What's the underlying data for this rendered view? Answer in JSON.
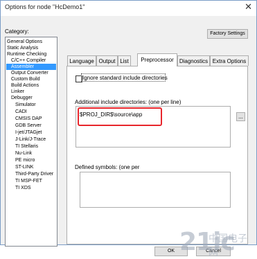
{
  "window": {
    "title": "Options for node \"HcDemo1\"",
    "close_glyph": "✕"
  },
  "category": {
    "label": "Category:",
    "items": [
      {
        "label": "General Options"
      },
      {
        "label": "Static Analysis"
      },
      {
        "label": "Runtime Checking"
      },
      {
        "label": "C/C++ Compiler"
      },
      {
        "label": "Assembler",
        "selected": true
      },
      {
        "label": "Output Converter"
      },
      {
        "label": "Custom Build"
      },
      {
        "label": "Build Actions"
      },
      {
        "label": "Linker"
      },
      {
        "label": "Debugger"
      },
      {
        "label": "Simulator"
      },
      {
        "label": "CADI"
      },
      {
        "label": "CMSIS DAP"
      },
      {
        "label": "GDB Server"
      },
      {
        "label": "I-jet/JTAGjet"
      },
      {
        "label": "J-Link/J-Trace"
      },
      {
        "label": "TI Stellaris"
      },
      {
        "label": "Nu-Link"
      },
      {
        "label": "PE micro"
      },
      {
        "label": "ST-LINK"
      },
      {
        "label": "Third-Party Driver"
      },
      {
        "label": "TI MSP-FET"
      },
      {
        "label": "TI XDS"
      }
    ]
  },
  "factory_settings": "Factory Settings",
  "tabs": [
    {
      "label": "Language"
    },
    {
      "label": "Output"
    },
    {
      "label": "List"
    },
    {
      "label": "Preprocessor",
      "active": true
    },
    {
      "label": "Diagnostics"
    },
    {
      "label": "Extra Options"
    }
  ],
  "preprocessor": {
    "ignore_label": "Ignore standard include directories",
    "include_label": "Additional include directories: (one per line)",
    "include_value": "$PROJ_DIR$\\source\\app",
    "browse_label": "...",
    "defined_label": "Defined symbols: (one per"
  },
  "footer": {
    "ok": "OK",
    "cancel": "Cancel"
  },
  "watermark": {
    "text": "21ic",
    "sub": "中国电子网"
  },
  "colors": {
    "selection": "#3399ff",
    "highlight": "#e8262c"
  }
}
